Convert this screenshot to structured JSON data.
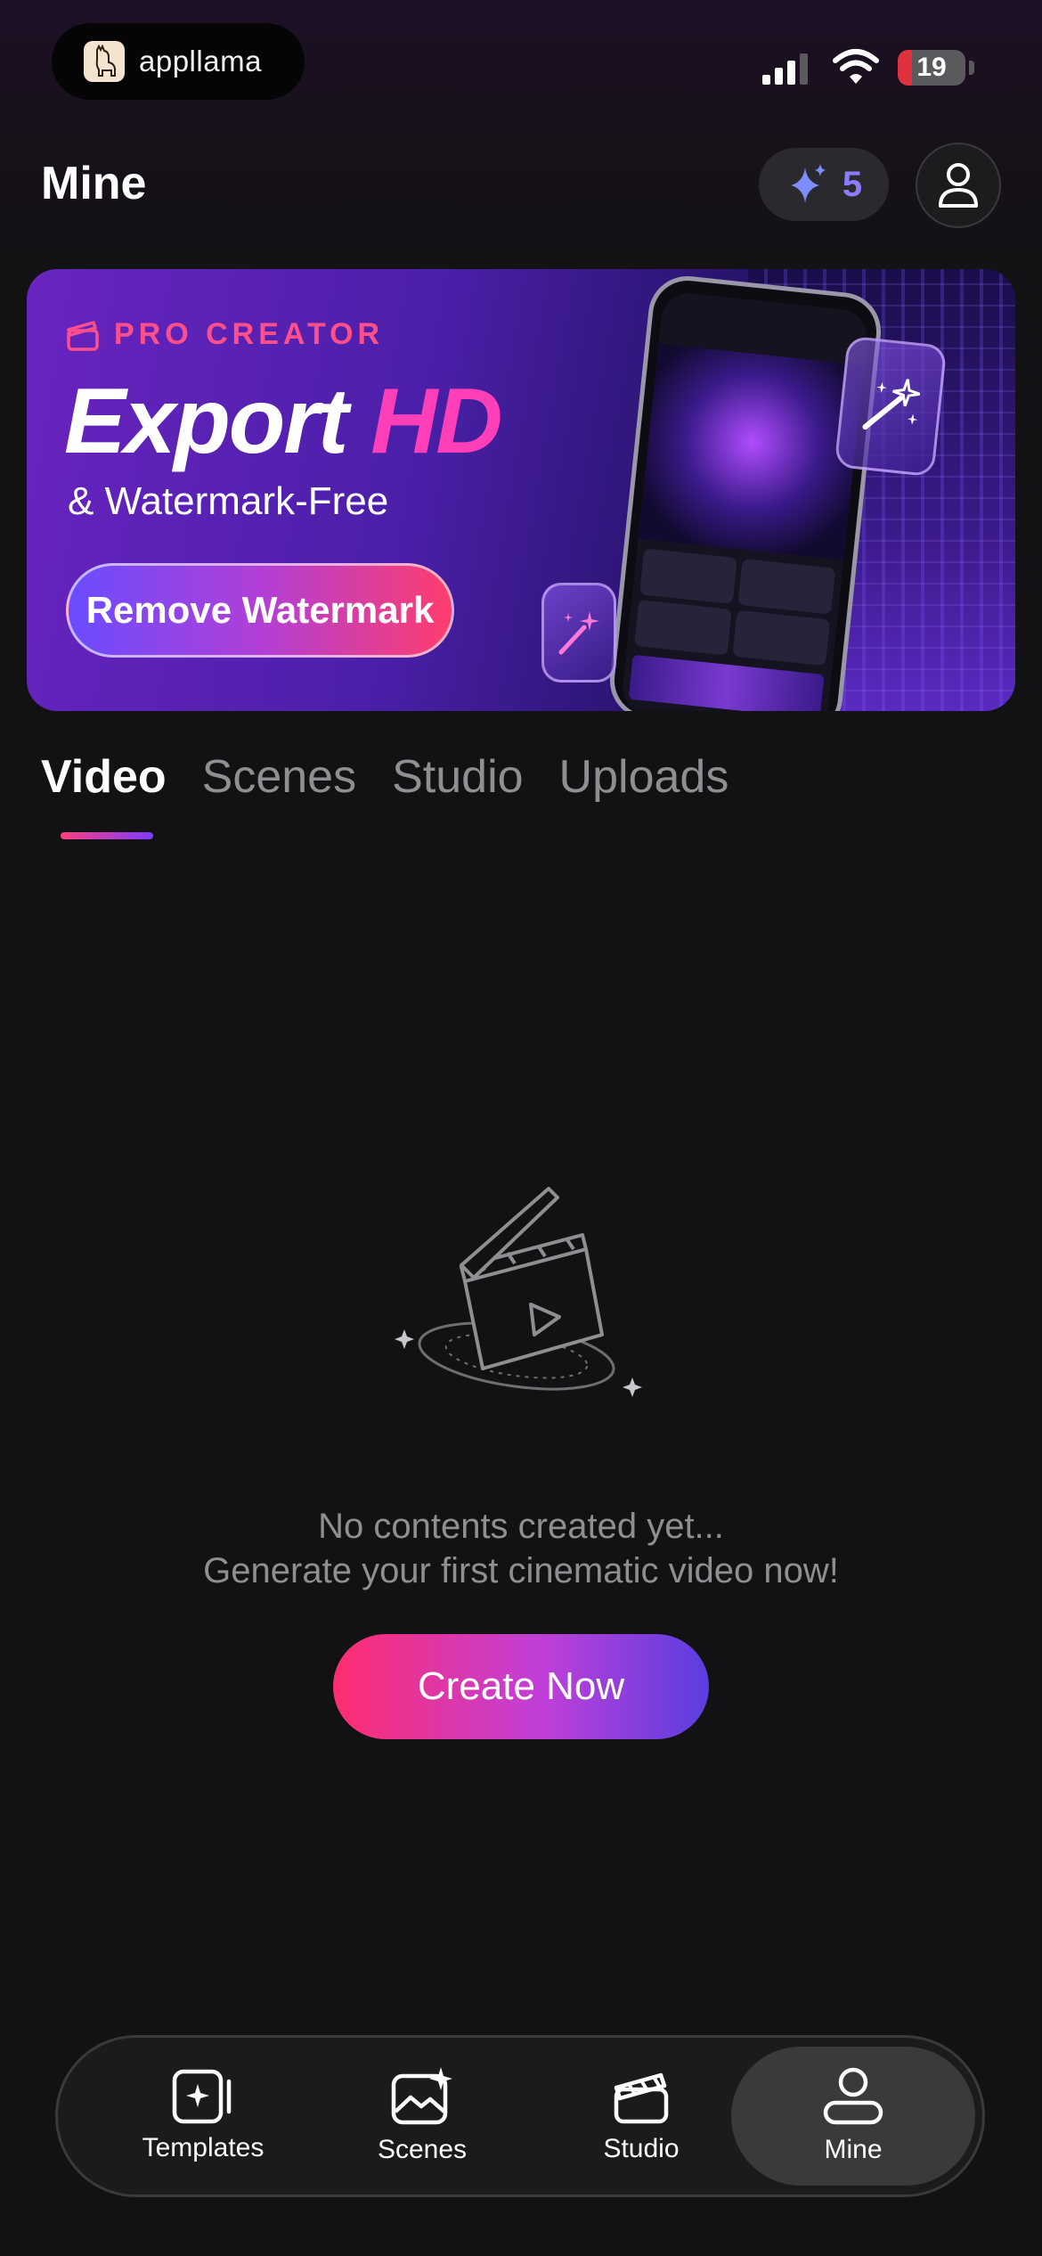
{
  "status_bar": {
    "app_brand": "appllama",
    "battery": "19"
  },
  "header": {
    "title": "Mine",
    "credits_count": "5"
  },
  "banner": {
    "eyebrow": "PRO CREATOR",
    "headline_white": "Export ",
    "headline_accent": "HD",
    "subheadline": "& Watermark-Free",
    "cta_label": "Remove Watermark"
  },
  "tabs": [
    {
      "label": "Video",
      "active": true
    },
    {
      "label": "Scenes",
      "active": false
    },
    {
      "label": "Studio",
      "active": false
    },
    {
      "label": "Uploads",
      "active": false
    }
  ],
  "empty_state": {
    "line1": "No contents created yet...",
    "line2": "Generate your first cinematic video now!",
    "cta_label": "Create Now"
  },
  "bottom_nav": [
    {
      "label": "Templates",
      "icon": "templates-icon",
      "active": false
    },
    {
      "label": "Scenes",
      "icon": "scenes-icon",
      "active": false
    },
    {
      "label": "Studio",
      "icon": "clapperboard-icon",
      "active": false
    },
    {
      "label": "Mine",
      "icon": "user-icon",
      "active": true
    }
  ],
  "colors": {
    "background": "#121214",
    "accent_pink": "#ff3d7f",
    "accent_purple": "#7b3dff",
    "credits_text": "#8b7cff"
  }
}
